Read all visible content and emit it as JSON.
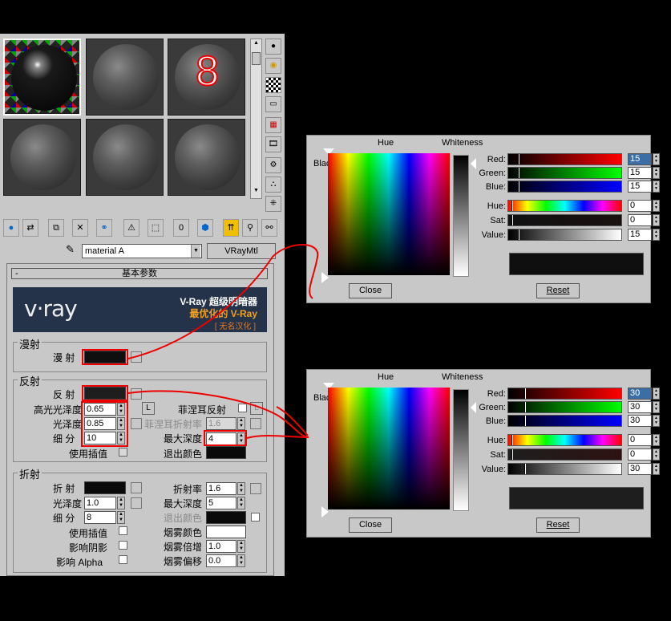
{
  "material_editor": {
    "slot_number_label": "8",
    "material_name": "material A",
    "material_type_button": "VRayMtl",
    "rollout_title": "基本参数",
    "rollout_collapse": "-",
    "banner": {
      "logo_text": "v·ray",
      "line1": "V-Ray 超级明暗器",
      "line2": "最优化的 V-Ray",
      "line3": "[ 无名汉化 ]"
    },
    "diffuse": {
      "group_title": "漫射",
      "label": "漫  射"
    },
    "reflection": {
      "group_title": "反射",
      "reflect_label": "反  射",
      "hilight_gloss_label": "高光光泽度",
      "hilight_gloss_value": "0.65",
      "hilight_lock_button": "L",
      "gloss_label": "光泽度",
      "gloss_value": "0.85",
      "subdivs_label": "细  分",
      "subdivs_value": "10",
      "use_interp_label": "使用插值",
      "fresnel_label": "菲涅耳反射",
      "fresnel_lock_button": "L",
      "fresnel_ior_label": "菲涅耳折射率",
      "fresnel_ior_value": "1.6",
      "max_depth_label": "最大深度",
      "max_depth_value": "4",
      "exit_color_label": "退出颜色"
    },
    "refraction": {
      "group_title": "折射",
      "refract_label": "折  射",
      "gloss_label": "光泽度",
      "gloss_value": "1.0",
      "subdivs_label": "细  分",
      "subdivs_value": "8",
      "use_interp_label": "使用插值",
      "affect_shadows_label": "影响阴影",
      "affect_alpha_label": "影响 Alpha",
      "ior_label": "折射率",
      "ior_value": "1.6",
      "max_depth_label": "最大深度",
      "max_depth_value": "5",
      "exit_color_label": "退出颜色",
      "fog_color_label": "烟雾颜色",
      "fog_mult_label": "烟雾倍增",
      "fog_mult_value": "1.0",
      "fog_bias_label": "烟雾偏移",
      "fog_bias_value": "0.0"
    }
  },
  "pickers": [
    {
      "hue_header": "Hue",
      "whiteness_header": "Whiteness",
      "blackness_label": "Blackness",
      "red_label": "Red:",
      "red_value": "15",
      "green_label": "Green:",
      "green_value": "15",
      "blue_label": "Blue:",
      "blue_value": "15",
      "hue_label": "Hue:",
      "hue_value": "0",
      "sat_label": "Sat:",
      "sat_value": "0",
      "value_label": "Value:",
      "value_value": "15",
      "close_button": "Close",
      "reset_button": "Reset",
      "preview_color": "#0f0f0f",
      "level": 0.059
    },
    {
      "hue_header": "Hue",
      "whiteness_header": "Whiteness",
      "blackness_label": "Blackness",
      "red_label": "Red:",
      "red_value": "30",
      "green_label": "Green:",
      "green_value": "30",
      "blue_label": "Blue:",
      "blue_value": "30",
      "hue_label": "Hue:",
      "hue_value": "0",
      "sat_label": "Sat:",
      "sat_value": "0",
      "value_label": "Value:",
      "value_value": "30",
      "close_button": "Close",
      "reset_button": "Reset",
      "preview_color": "#1e1e1e",
      "level": 0.118
    }
  ],
  "colors": {
    "annotation_red": "#e00000",
    "diffuse_swatch": "#0f0f0f",
    "reflect_swatch": "#1e1e1e",
    "panel_grey": "#c8c8c8"
  }
}
